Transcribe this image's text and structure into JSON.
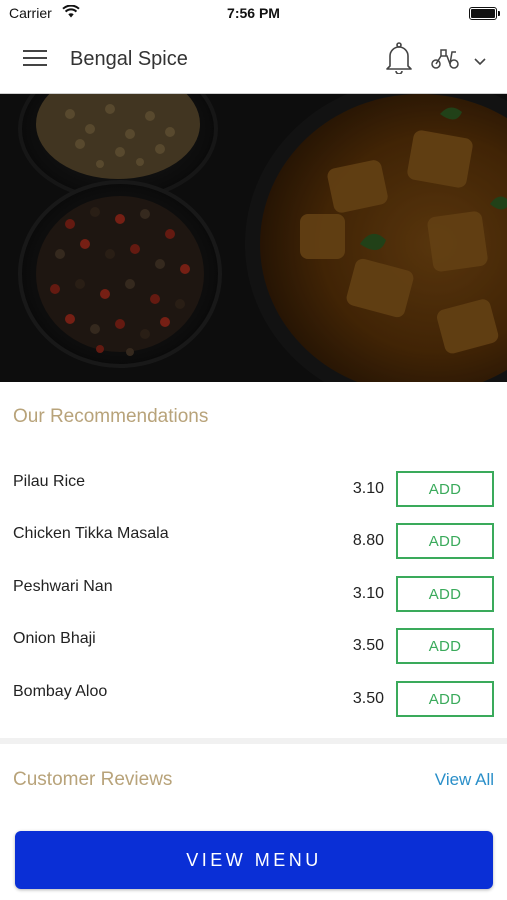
{
  "status_bar": {
    "carrier": "Carrier",
    "time": "7:56 PM"
  },
  "header": {
    "title": "Bengal Spice",
    "icons": [
      "menu-icon",
      "bell-icon",
      "scooter-icon",
      "chevron-down-icon"
    ]
  },
  "hero": {
    "image": "food-photo"
  },
  "recommendations": {
    "title": "Our Recommendations",
    "items": [
      {
        "name": "Pilau Rice",
        "price": "3.10",
        "button": "ADD"
      },
      {
        "name": "Chicken Tikka Masala",
        "price": "8.80",
        "button": "ADD"
      },
      {
        "name": "Peshwari Nan",
        "price": "3.10",
        "button": "ADD"
      },
      {
        "name": "Onion Bhaji",
        "price": "3.50",
        "button": "ADD"
      },
      {
        "name": "Bombay Aloo",
        "price": "3.50",
        "button": "ADD"
      }
    ]
  },
  "reviews": {
    "title": "Customer Reviews",
    "view_all": "View All"
  },
  "footer": {
    "view_menu_label": "VIEW MENU"
  },
  "colors": {
    "accent_gold": "#b8a37a",
    "add_green": "#3aaa5b",
    "link_blue": "#2a8fc9",
    "button_blue": "#0a2fd6"
  }
}
